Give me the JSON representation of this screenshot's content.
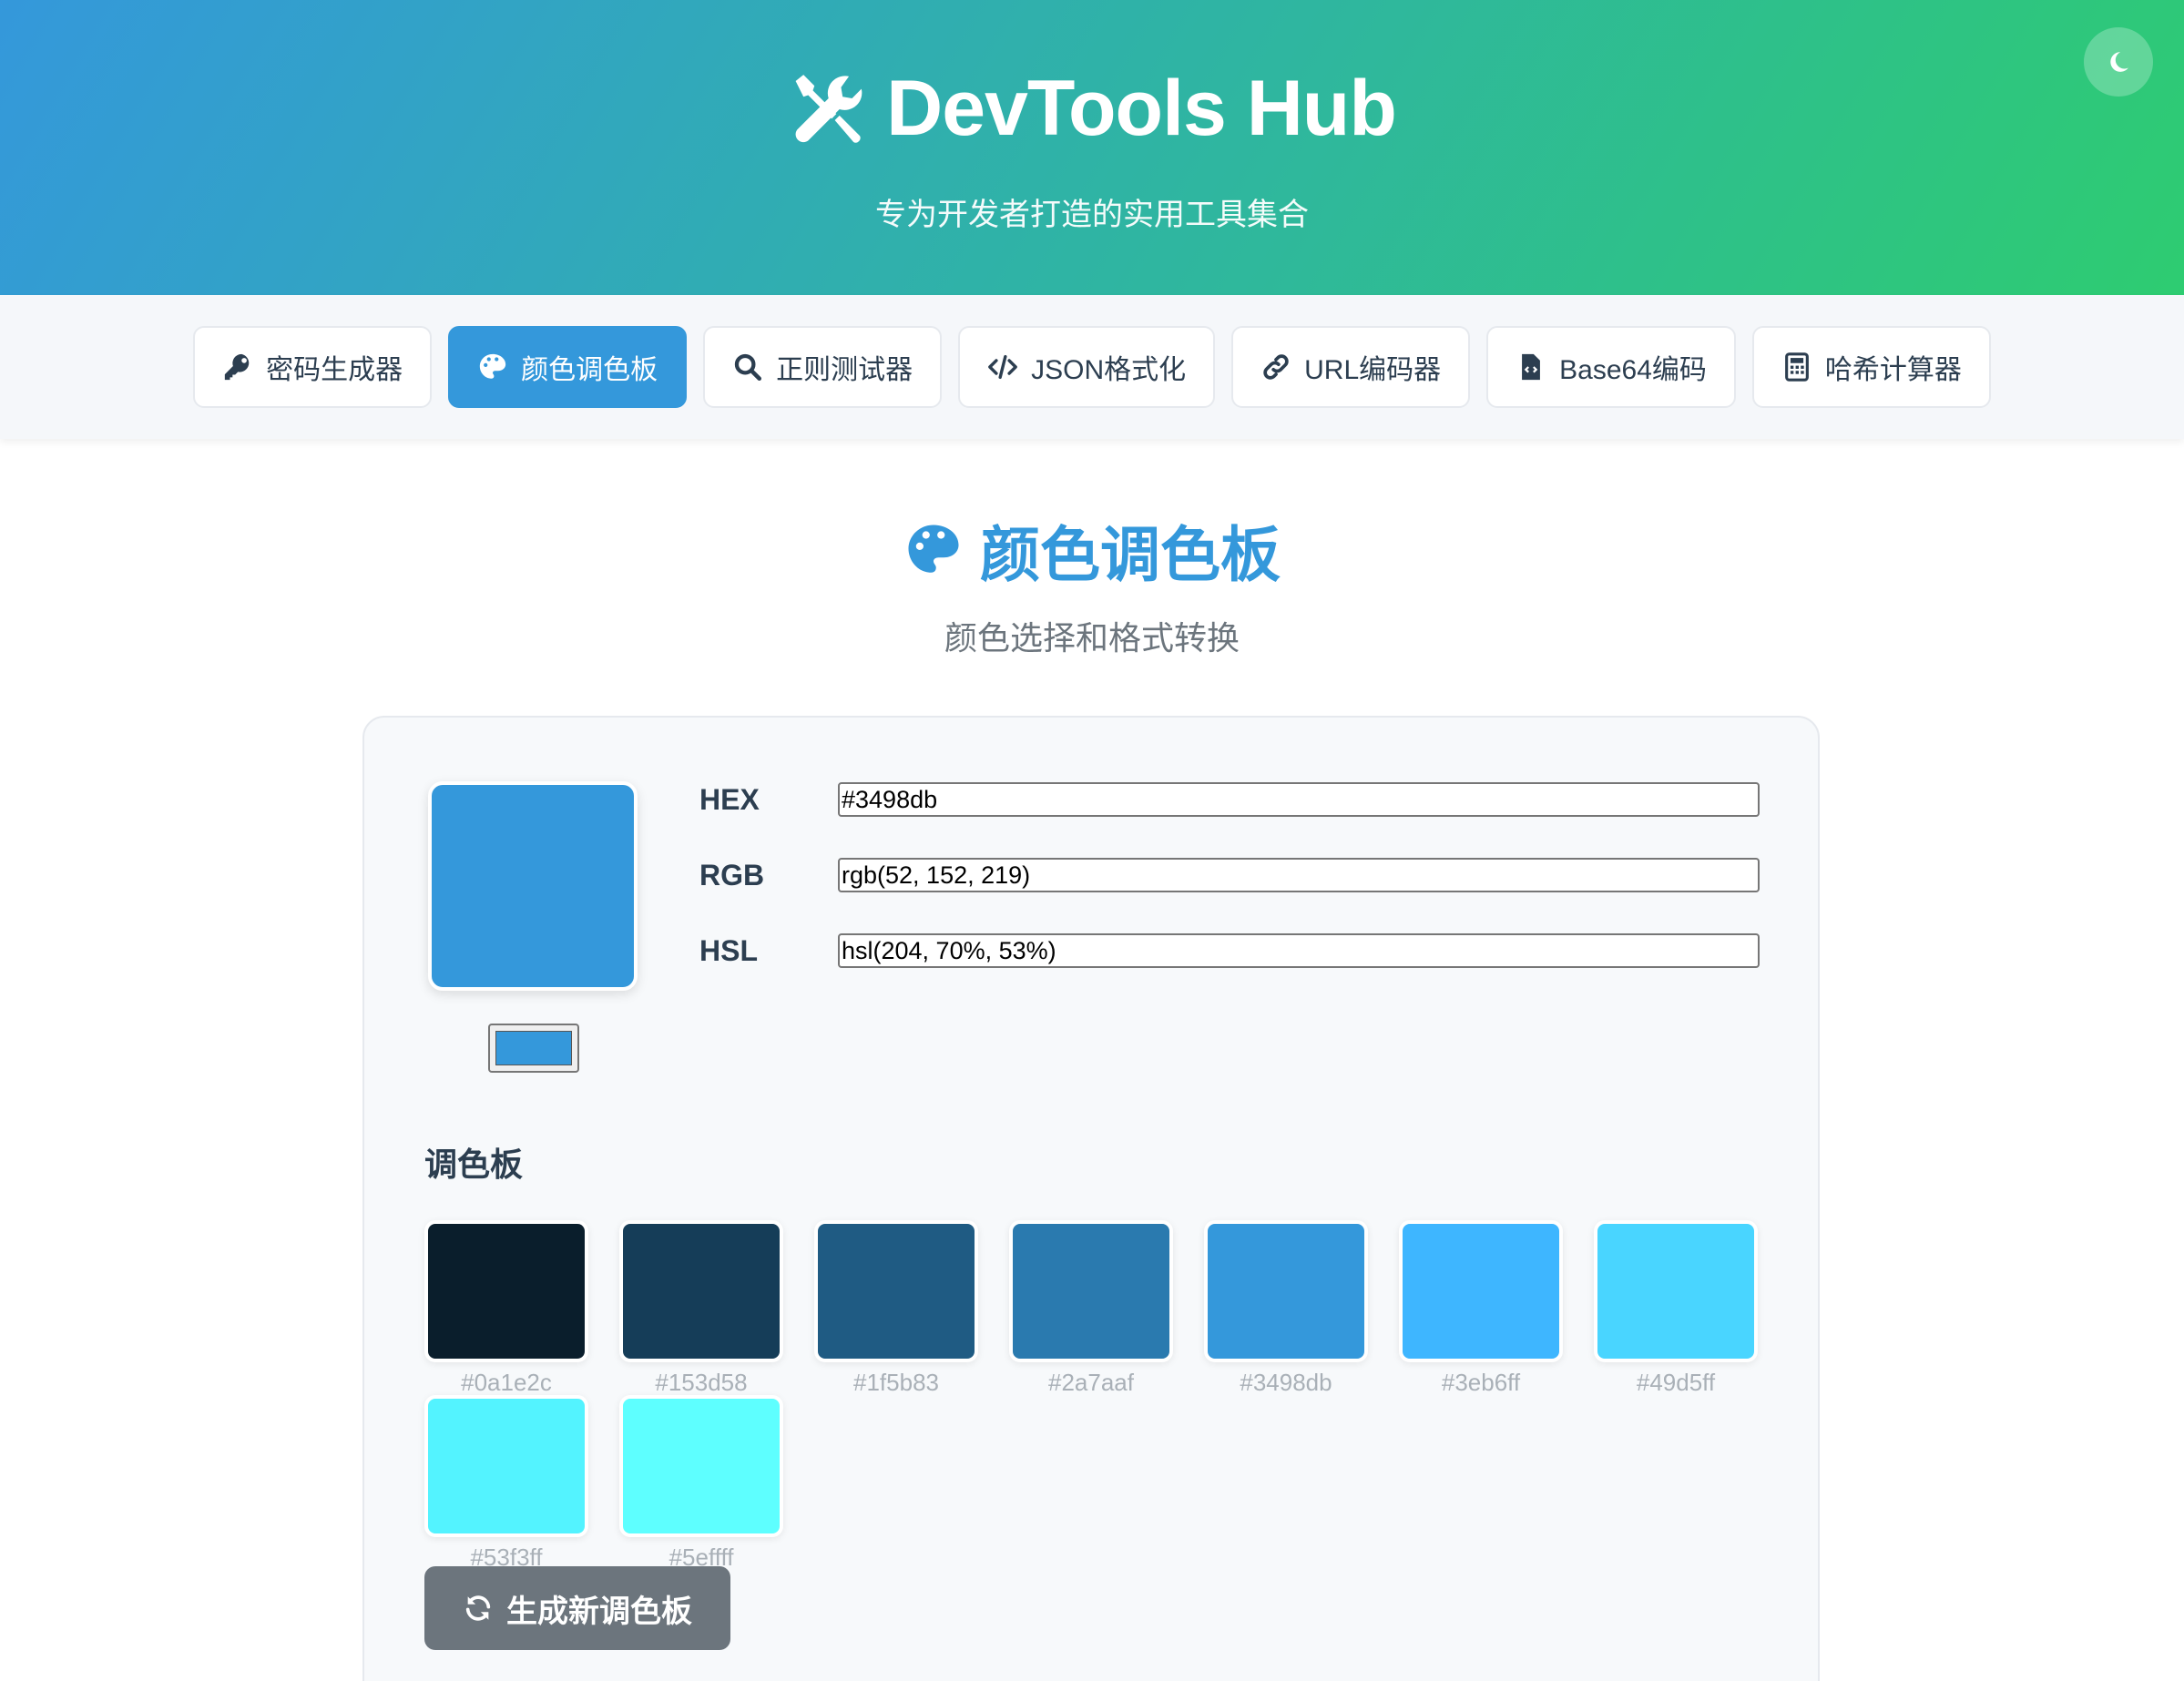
{
  "header": {
    "title": "DevTools Hub",
    "subtitle": "专为开发者打造的实用工具集合",
    "logo_icon": "tools-icon",
    "theme_toggle_icon": "moon-icon"
  },
  "nav": {
    "items": [
      {
        "label": "密码生成器",
        "icon": "key-icon",
        "active": false
      },
      {
        "label": "颜色调色板",
        "icon": "palette-icon",
        "active": true
      },
      {
        "label": "正则测试器",
        "icon": "search-icon",
        "active": false
      },
      {
        "label": "JSON格式化",
        "icon": "code-icon",
        "active": false
      },
      {
        "label": "URL编码器",
        "icon": "link-icon",
        "active": false
      },
      {
        "label": "Base64编码",
        "icon": "file-code-icon",
        "active": false
      },
      {
        "label": "哈希计算器",
        "icon": "calculator-icon",
        "active": false
      }
    ]
  },
  "section": {
    "title": "颜色调色板",
    "subtitle": "颜色选择和格式转换"
  },
  "color": {
    "current": "#3498db",
    "formats": [
      {
        "label": "HEX",
        "value": "#3498db"
      },
      {
        "label": "RGB",
        "value": "rgb(52, 152, 219)"
      },
      {
        "label": "HSL",
        "value": "hsl(204, 70%, 53%)"
      }
    ]
  },
  "palette": {
    "title": "调色板",
    "swatches": [
      "#0a1e2c",
      "#153d58",
      "#1f5b83",
      "#2a7aaf",
      "#3498db",
      "#3eb6ff",
      "#49d5ff",
      "#53f3ff",
      "#5effff"
    ]
  },
  "generate_button": {
    "label": "生成新调色板",
    "icon": "refresh-icon"
  },
  "colors": {
    "accent": "#3498db",
    "header_gradient_start": "#3498db",
    "header_gradient_end": "#2ecc71",
    "button_gray": "#6c757d"
  }
}
